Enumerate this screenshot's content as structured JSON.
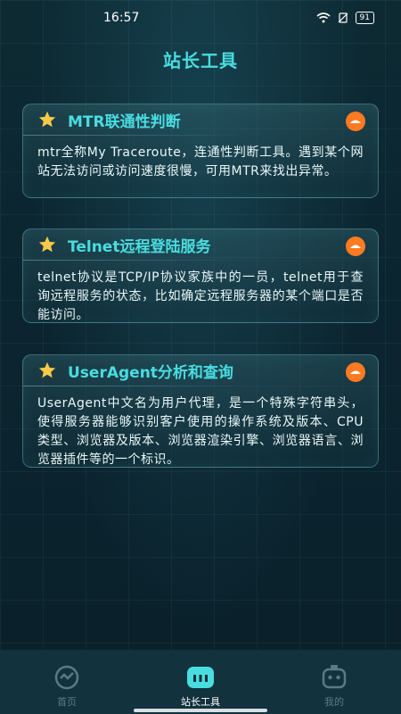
{
  "status": {
    "time": "16:57",
    "battery": "91"
  },
  "page": {
    "title": "站长工具"
  },
  "cards": [
    {
      "title": "MTR联通性判断",
      "description": "mtr全称My Traceroute，连通性判断工具。遇到某个网站无法访问或访问速度很慢，可用MTR来找出异常。"
    },
    {
      "title": "Telnet远程登陆服务",
      "description": "telnet协议是TCP/IP协议家族中的一员，telnet用于查询远程服务的状态，比如确定远程服务器的某个端口是否能访问。"
    },
    {
      "title": "UserAgent分析和查询",
      "description": "UserAgent中文名为用户代理，是一个特殊字符串头，使得服务器能够识别客户使用的操作系统及版本、CPU 类型、浏览器及版本、浏览器渲染引擎、浏览器语言、浏览器插件等的一个标识。"
    }
  ],
  "tabs": [
    {
      "label": "首页",
      "icon": "chart-circle-icon",
      "active": false
    },
    {
      "label": "站长工具",
      "icon": "toolbox-icon",
      "active": true
    },
    {
      "label": "我的",
      "icon": "robot-icon",
      "active": false
    }
  ],
  "colors": {
    "accent": "#49dde0",
    "star": "#f7c948",
    "toggle": "#ff7a21",
    "tabbar": "#12323d"
  }
}
